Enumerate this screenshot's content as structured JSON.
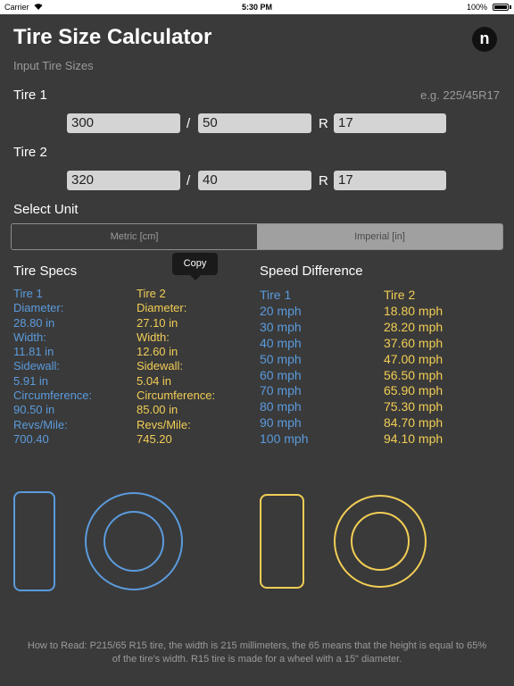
{
  "status_bar": {
    "carrier": "Carrier",
    "time": "5:30 PM",
    "battery": "100%"
  },
  "header": {
    "title": "Tire Size Calculator",
    "logo": "n",
    "subtitle": "Input Tire Sizes"
  },
  "tire1_input": {
    "label": "Tire 1",
    "hint": "e.g. 225/45R17",
    "width": "300",
    "aspect": "50",
    "rim_sep": "R",
    "rim": "17",
    "slash": "/"
  },
  "tire2_input": {
    "label": "Tire 2",
    "width": "320",
    "aspect": "40",
    "rim_sep": "R",
    "rim": "17",
    "slash": "/"
  },
  "unit": {
    "label": "Select Unit",
    "options": [
      "Metric [cm]",
      "Imperial [in]"
    ],
    "selected": "Imperial [in]"
  },
  "tooltip": "Copy",
  "tire_specs": {
    "title": "Tire Specs",
    "tire1": [
      "Tire 1",
      "Diameter:",
      "28.80 in",
      "Width:",
      "11.81 in",
      "Sidewall:",
      "5.91 in",
      "Circumference:",
      "90.50 in",
      "Revs/Mile:",
      "700.40"
    ],
    "tire2": [
      "Tire 2",
      "Diameter:",
      "27.10 in",
      "Width:",
      "12.60 in",
      "Sidewall:",
      "5.04 in",
      "Circumference:",
      "85.00 in",
      "Revs/Mile:",
      "745.20"
    ]
  },
  "speed_difference": {
    "title": "Speed Difference",
    "tire1": [
      "Tire 1",
      "20 mph",
      "30 mph",
      "40 mph",
      "50 mph",
      "60 mph",
      "70 mph",
      "80 mph",
      "90 mph",
      "100 mph"
    ],
    "tire2": [
      "Tire 2",
      "18.80 mph",
      "28.20 mph",
      "37.60 mph",
      "47.00 mph",
      "56.50 mph",
      "65.90 mph",
      "75.30 mph",
      "84.70 mph",
      "94.10 mph"
    ]
  },
  "footer": "How to Read: P215/65 R15 tire, the width is 215 millimeters, the 65 means that the height is equal to 65% of the tire's width. R15 tire is made for a wheel with a 15\" diameter.",
  "colors": {
    "tire1": "#5b9bdc",
    "tire2": "#f1cd55",
    "background": "#3a3a3a"
  }
}
